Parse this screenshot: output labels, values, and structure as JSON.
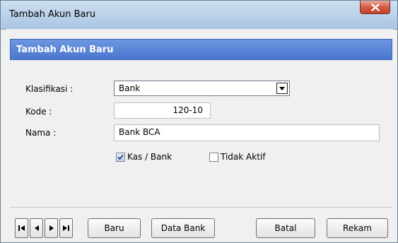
{
  "window": {
    "title": "Tambah Akun Baru",
    "close_icon": "close-icon"
  },
  "header": {
    "title": "Tambah Akun Baru",
    "background_color": "#5580d8"
  },
  "form": {
    "klasifikasi_label": "Klasifikasi :",
    "klasifikasi_value": "Bank",
    "kode_label": "Kode :",
    "kode_value": "120-10",
    "nama_label": "Nama :",
    "nama_value": "Bank BCA",
    "kas_bank_label": "Kas / Bank",
    "kas_bank_checked": true,
    "tidak_aktif_label": "Tidak Aktif",
    "tidak_aktif_checked": false
  },
  "navigation": {
    "first_icon": "first-record-icon",
    "prev_icon": "previous-record-icon",
    "next_icon": "next-record-icon",
    "last_icon": "last-record-icon"
  },
  "buttons": {
    "baru": "Baru",
    "data_bank": "Data Bank",
    "batal": "Batal",
    "rekam": "Rekam"
  }
}
